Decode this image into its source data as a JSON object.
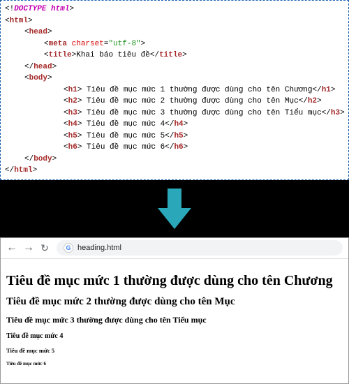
{
  "code": {
    "doctype": "DOCTYPE html",
    "html_open": "html",
    "head_open": "head",
    "meta_tag": "meta",
    "meta_attr": "charset",
    "meta_val": "\"utf-8\"",
    "title_tag": "title",
    "title_text": "Khai báo tiêu đề",
    "head_close": "head",
    "body_open": "body",
    "headings": [
      {
        "tag": "h1",
        "text": " Tiêu đề mục mức 1 thường được dùng cho tên Chương"
      },
      {
        "tag": "h2",
        "text": " Tiêu đề mục mức 2 thường được dùng cho tên Mục"
      },
      {
        "tag": "h3",
        "text": " Tiêu đề mục mức 3 thường được dùng cho tên Tiểu mục"
      },
      {
        "tag": "h4",
        "text": " Tiêu đề mục mức 4"
      },
      {
        "tag": "h5",
        "text": " Tiêu đề mục mức 5"
      },
      {
        "tag": "h6",
        "text": " Tiêu đề mục mức 6"
      }
    ],
    "body_close": "body",
    "html_close": "html"
  },
  "browser": {
    "url": "heading.html",
    "render": {
      "h1": "Tiêu đề mục mức 1 thường được dùng cho tên Chương",
      "h2": "Tiêu đề mục mức 2 thường được dùng cho tên Mục",
      "h3": "Tiêu đề mục mức 3 thường được dùng cho tên Tiểu mục",
      "h4": "Tiêu đề mục mức 4",
      "h5": "Tiêu đề mục mức 5",
      "h6": "Tiêu đề mục mức 6"
    }
  },
  "arrow_color": "#2aa7b8"
}
